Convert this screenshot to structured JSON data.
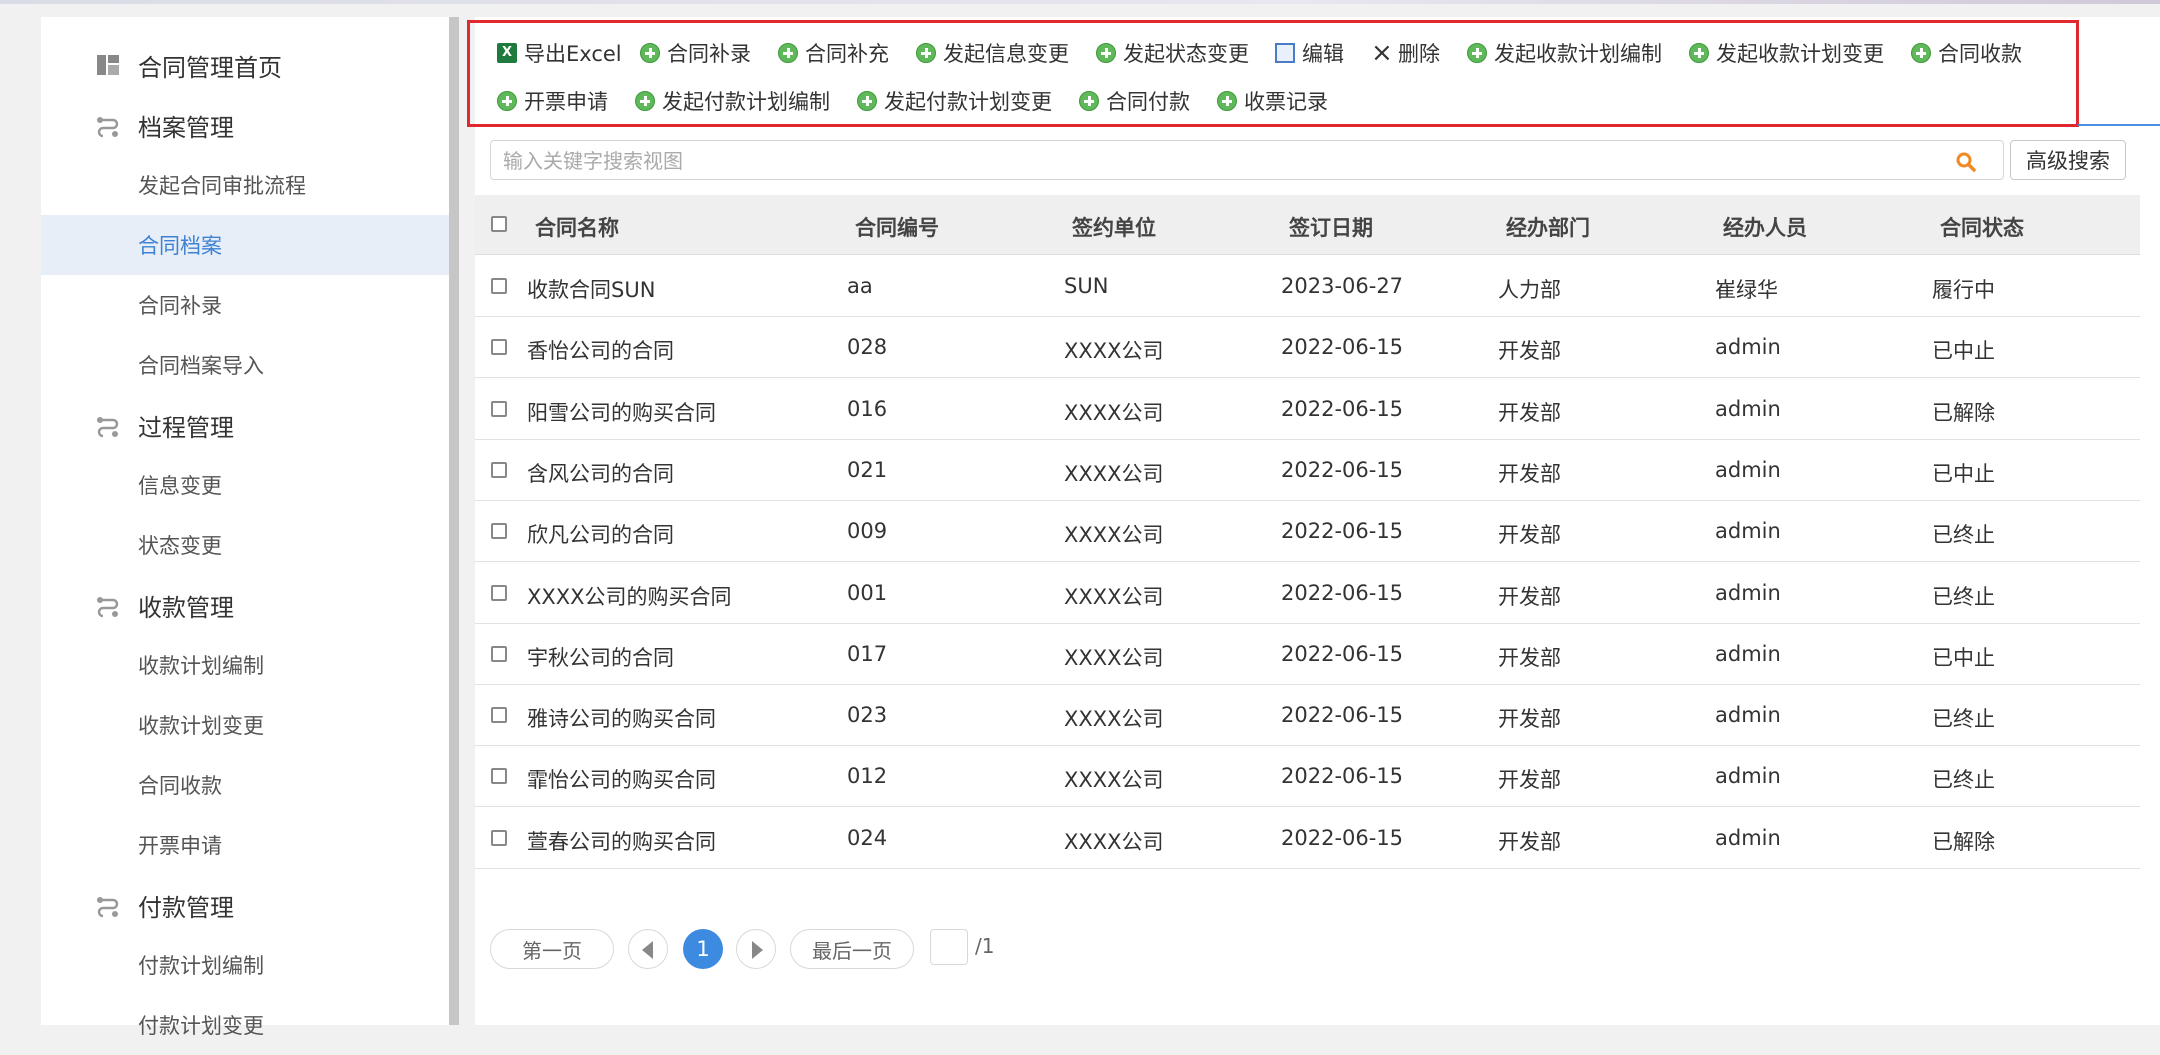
{
  "sidebar": {
    "items": [
      {
        "label": "合同管理首页",
        "type": "group",
        "icon": "dashboard-icon"
      },
      {
        "label": "档案管理",
        "type": "group",
        "icon": "flow-icon"
      },
      {
        "label": "发起合同审批流程",
        "type": "sub"
      },
      {
        "label": "合同档案",
        "type": "sub",
        "active": true
      },
      {
        "label": "合同补录",
        "type": "sub"
      },
      {
        "label": "合同档案导入",
        "type": "sub"
      },
      {
        "label": "过程管理",
        "type": "group",
        "icon": "flow-icon"
      },
      {
        "label": "信息变更",
        "type": "sub"
      },
      {
        "label": "状态变更",
        "type": "sub"
      },
      {
        "label": "收款管理",
        "type": "group",
        "icon": "flow-icon"
      },
      {
        "label": "收款计划编制",
        "type": "sub"
      },
      {
        "label": "收款计划变更",
        "type": "sub"
      },
      {
        "label": "合同收款",
        "type": "sub"
      },
      {
        "label": "开票申请",
        "type": "sub"
      },
      {
        "label": "付款管理",
        "type": "group",
        "icon": "flow-icon"
      },
      {
        "label": "付款计划编制",
        "type": "sub"
      },
      {
        "label": "付款计划变更",
        "type": "sub"
      }
    ]
  },
  "toolbar": {
    "export_excel": "导出Excel",
    "contract_supplement_record": "合同补录",
    "contract_supplement": "合同补充",
    "start_info_change": "发起信息变更",
    "start_status_change": "发起状态变更",
    "edit": "编辑",
    "delete": "删除",
    "start_collection_plan": "发起收款计划编制",
    "start_collection_plan_change": "发起收款计划变更",
    "contract_collection": "合同收款",
    "invoice_request": "开票申请",
    "start_payment_plan": "发起付款计划编制",
    "start_payment_plan_change": "发起付款计划变更",
    "contract_payment": "合同付款",
    "receipt_record": "收票记录"
  },
  "search": {
    "placeholder": "输入关键字搜索视图",
    "advanced_label": "高级搜索"
  },
  "table": {
    "headers": [
      "合同名称",
      "合同编号",
      "签约单位",
      "签订日期",
      "经办部门",
      "经办人员",
      "合同状态"
    ],
    "rows": [
      [
        "收款合同SUN",
        "aa",
        "SUN",
        "2023-06-27",
        "人力部",
        "崔绿华",
        "履行中"
      ],
      [
        "香怡公司的合同",
        "028",
        "XXXX公司",
        "2022-06-15",
        "开发部",
        "admin",
        "已中止"
      ],
      [
        "阳雪公司的购买合同",
        "016",
        "XXXX公司",
        "2022-06-15",
        "开发部",
        "admin",
        "已解除"
      ],
      [
        "含风公司的合同",
        "021",
        "XXXX公司",
        "2022-06-15",
        "开发部",
        "admin",
        "已中止"
      ],
      [
        "欣凡公司的合同",
        "009",
        "XXXX公司",
        "2022-06-15",
        "开发部",
        "admin",
        "已终止"
      ],
      [
        "XXXX公司的购买合同",
        "001",
        "XXXX公司",
        "2022-06-15",
        "开发部",
        "admin",
        "已终止"
      ],
      [
        "宇秋公司的合同",
        "017",
        "XXXX公司",
        "2022-06-15",
        "开发部",
        "admin",
        "已中止"
      ],
      [
        "雅诗公司的购买合同",
        "023",
        "XXXX公司",
        "2022-06-15",
        "开发部",
        "admin",
        "已终止"
      ],
      [
        "霏怡公司的购买合同",
        "012",
        "XXXX公司",
        "2022-06-15",
        "开发部",
        "admin",
        "已终止"
      ],
      [
        "萱春公司的购买合同",
        "024",
        "XXXX公司",
        "2022-06-15",
        "开发部",
        "admin",
        "已解除"
      ]
    ]
  },
  "pagination": {
    "first_label": "第一页",
    "last_label": "最后一页",
    "current_page": "1",
    "total_pages": "/1"
  },
  "colors": {
    "accent": "#3d8be0",
    "highlight_frame": "#e0282e",
    "add_icon": "#5fb85a"
  }
}
